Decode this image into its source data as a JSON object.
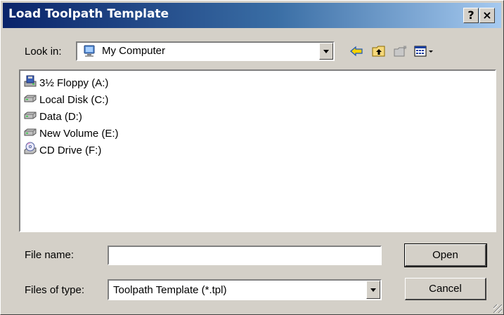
{
  "window": {
    "title": "Load Toolpath Template",
    "help_label": "?",
    "close_label": "×"
  },
  "lookin": {
    "label": "Look in:",
    "value": "My Computer",
    "value_icon": "computer-icon"
  },
  "toolbar": {
    "back_icon": "back-arrow-icon",
    "up_icon": "up-folder-icon",
    "new_folder_icon": "new-folder-icon",
    "view_menu_icon": "view-menu-icon"
  },
  "files": [
    {
      "label": "3½ Floppy (A:)",
      "icon": "floppy-drive-icon"
    },
    {
      "label": "Local Disk (C:)",
      "icon": "hard-drive-icon"
    },
    {
      "label": "Data (D:)",
      "icon": "hard-drive-icon"
    },
    {
      "label": "New Volume (E:)",
      "icon": "hard-drive-icon"
    },
    {
      "label": "CD Drive (F:)",
      "icon": "cd-drive-icon"
    }
  ],
  "filename": {
    "label": "File name:",
    "value": ""
  },
  "filetype": {
    "label": "Files of type:",
    "value": "Toolpath Template (*.tpl)"
  },
  "buttons": {
    "open": "Open",
    "cancel": "Cancel"
  }
}
